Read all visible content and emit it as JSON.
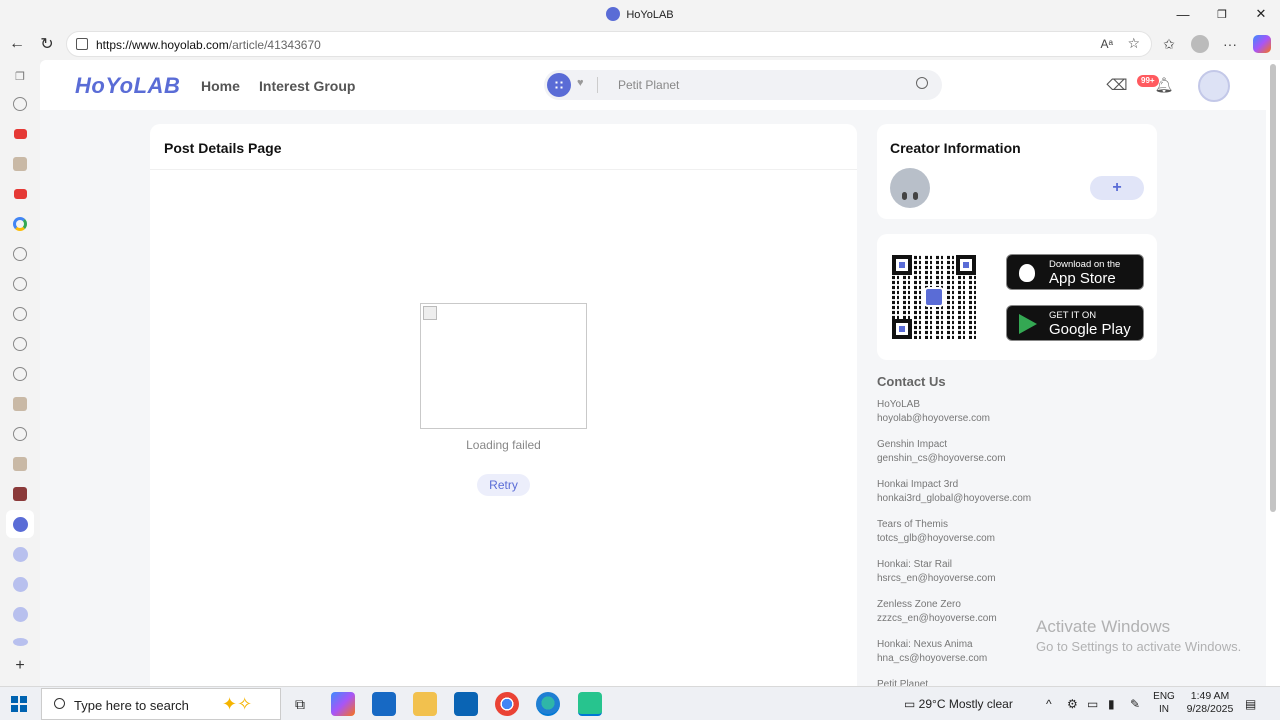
{
  "window": {
    "title": "HoYoLAB",
    "minimize": "—",
    "maximize": "❐",
    "close": "✕"
  },
  "browser": {
    "url_host": "https://www.hoyolab.com",
    "url_path": "/article/41343670",
    "read_aloud": "Aᵃ",
    "favorite": "☆"
  },
  "site": {
    "logo": "HoYoLAB",
    "nav": {
      "home": "Home",
      "interest_group": "Interest Group"
    },
    "search": {
      "placeholder": "Petit Planet"
    },
    "notification_badge": "99+",
    "accent_color": "#5a6cd6"
  },
  "main": {
    "header": "Post Details Page",
    "loading_failed": "Loading failed",
    "retry": "Retry"
  },
  "creator": {
    "heading": "Creator Information",
    "follow": "+"
  },
  "apps": {
    "app_store": {
      "line1": "Download on the",
      "line2": "App Store"
    },
    "google_play": {
      "line1": "GET IT ON",
      "line2": "Google Play"
    }
  },
  "contact": {
    "heading": "Contact Us",
    "items": [
      {
        "name": "HoYoLAB",
        "email": "hoyolab@hoyoverse.com"
      },
      {
        "name": "Genshin Impact",
        "email": "genshin_cs@hoyoverse.com"
      },
      {
        "name": "Honkai Impact 3rd",
        "email": "honkai3rd_global@hoyoverse.com"
      },
      {
        "name": "Tears of Themis",
        "email": "totcs_glb@hoyoverse.com"
      },
      {
        "name": "Honkai: Star Rail",
        "email": "hsrcs_en@hoyoverse.com"
      },
      {
        "name": "Zenless Zone Zero",
        "email": "zzzcs_en@hoyoverse.com"
      },
      {
        "name": "Honkai: Nexus Anima",
        "email": "hna_cs@hoyoverse.com"
      },
      {
        "name": "Petit Planet",
        "email": ""
      }
    ]
  },
  "watermark": {
    "line1": "Activate Windows",
    "line2": "Go to Settings to activate Windows."
  },
  "taskbar": {
    "search_text": "Type here to search",
    "weather": "29°C  Mostly clear",
    "lang_1": "ENG",
    "lang_2": "IN",
    "time": "1:49 AM",
    "date": "9/28/2025"
  }
}
